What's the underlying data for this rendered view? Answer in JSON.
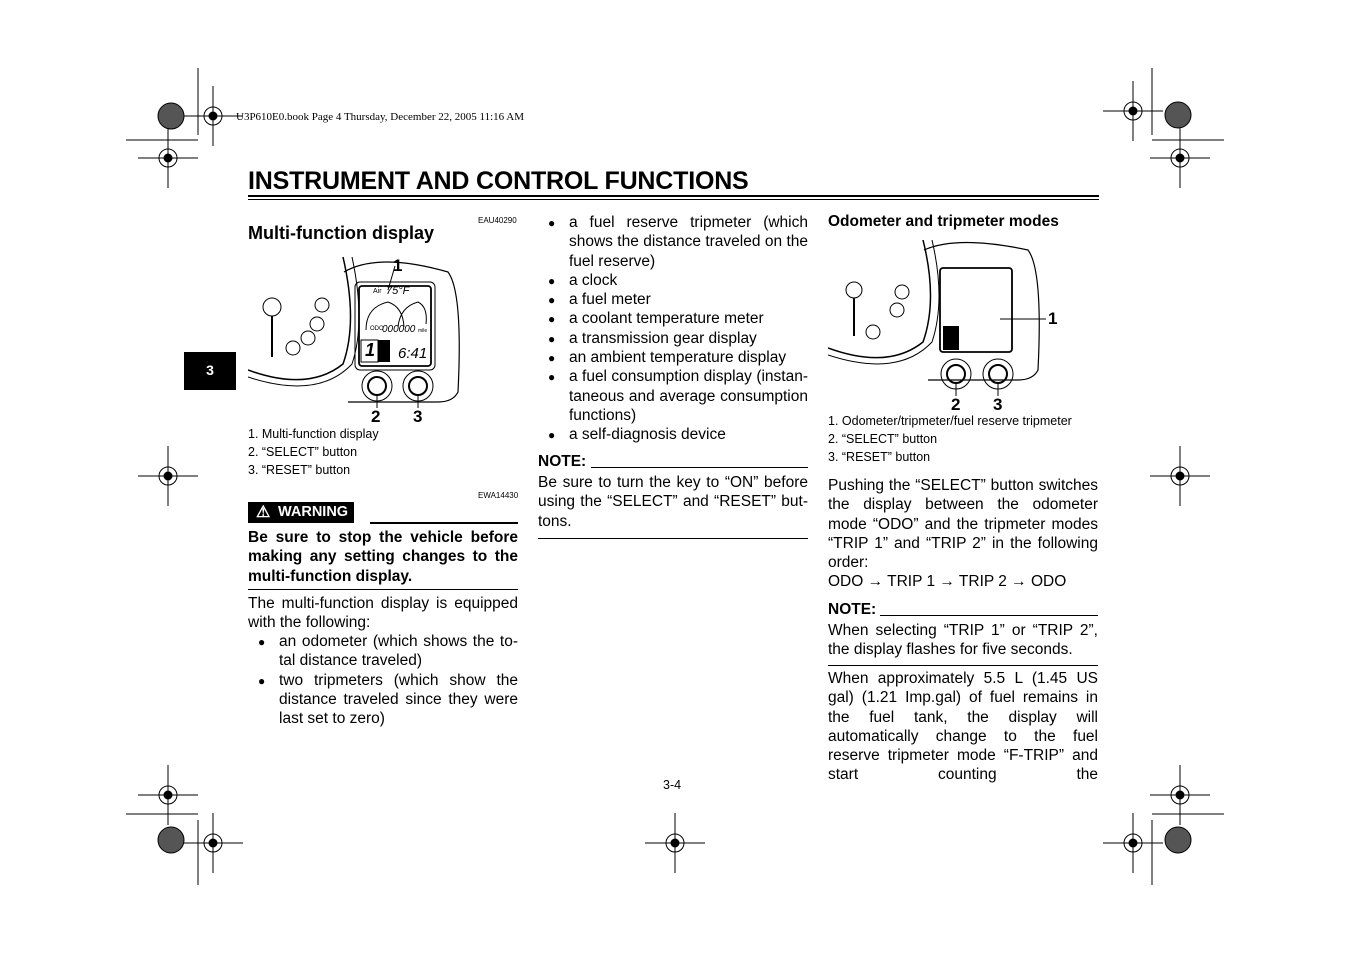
{
  "header": {
    "book_info": "U3P610E0.book  Page 4  Thursday, December 22, 2005  11:16 AM"
  },
  "page_title": "INSTRUMENT AND CONTROL FUNCTIONS",
  "chapter_tab": "3",
  "page_number": "3-4",
  "left": {
    "heading": "Multi-function display",
    "code": "EAU40290",
    "figure": {
      "callouts": [
        "1",
        "2",
        "3"
      ],
      "lcd": {
        "air": "Air",
        "temp": "75°F",
        "odo": "ODO",
        "odo_value": "000000",
        "unit": "mile",
        "gear": "1",
        "clock": "6:41"
      }
    },
    "captions": [
      "1.  Multi-function display",
      "2.  “SELECT” button",
      "3.  “RESET” button"
    ],
    "warning_code": "EWA14430",
    "warning_label": "WARNING",
    "warning_text": "Be sure to stop the vehicle before making any setting changes to the multi-function display.",
    "intro": "The multi-function display is equipped with the following:",
    "bullets": [
      "an odometer (which shows the to-tal distance traveled)",
      "two tripmeters (which show the distance traveled since they were last set to zero)"
    ]
  },
  "middle": {
    "bullets": [
      "a fuel reserve tripmeter (which shows the distance traveled on the fuel reserve)",
      "a clock",
      "a fuel meter",
      "a coolant temperature meter",
      "a transmission gear display",
      "an ambient temperature display",
      "a fuel consumption display (instan-taneous and average consumption functions)",
      "a self-diagnosis device"
    ],
    "note_label": "NOTE:",
    "note_text": "Be sure to turn the key to “ON” before using the “SELECT” and “RESET” but-tons."
  },
  "right": {
    "heading": "Odometer and tripmeter modes",
    "figure": {
      "callouts": [
        "1",
        "2",
        "3"
      ]
    },
    "captions": [
      "1.  Odometer/tripmeter/fuel reserve tripmeter",
      "2.  “SELECT” button",
      "3.  “RESET” button"
    ],
    "para1": "Pushing the “SELECT” button switches the display between the odometer mode “ODO” and the tripmeter modes “TRIP 1” and “TRIP 2” in the following order:",
    "order": "ODO → TRIP 1 → TRIP 2 → ODO",
    "note_label": "NOTE:",
    "note_text": "When selecting “TRIP 1” or “TRIP 2”, the display flashes for five seconds.",
    "para2": "When approximately 5.5 L (1.45 US gal) (1.21 Imp.gal) of fuel remains in the fuel tank, the display will automatically change to the fuel reserve tripmeter mode “F-TRIP” and start counting the"
  }
}
